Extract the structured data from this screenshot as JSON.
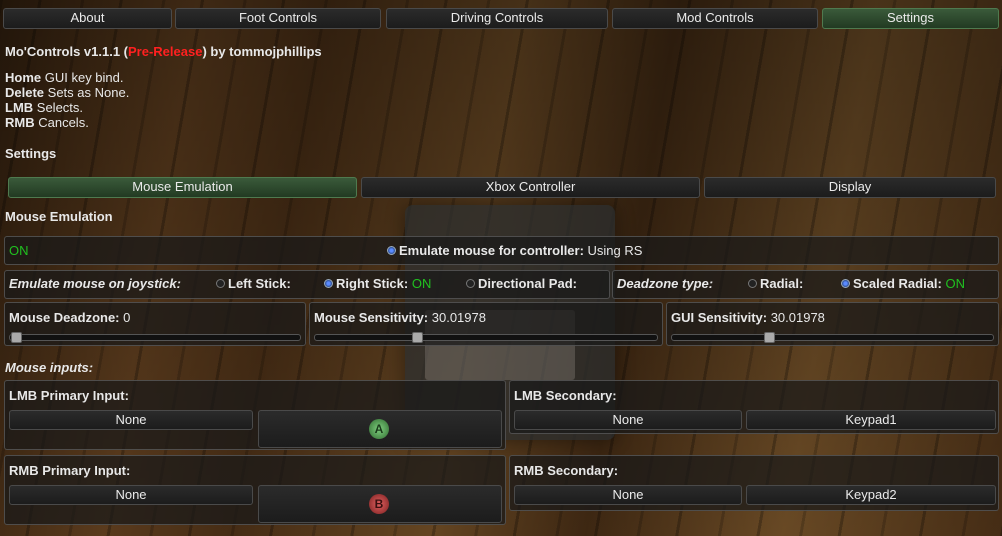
{
  "tabs": [
    {
      "label": "About"
    },
    {
      "label": "Foot Controls"
    },
    {
      "label": "Driving Controls"
    },
    {
      "label": "Mod Controls"
    },
    {
      "label": "Settings",
      "active": true
    }
  ],
  "header": {
    "title_prefix": "Mo'Controls v1.1.1 (",
    "prerelease": "Pre-Release",
    "title_suffix": ") by tommojphillips"
  },
  "keybinds": [
    {
      "key": "Home",
      "desc": " GUI key bind."
    },
    {
      "key": "Delete",
      "desc": " Sets as None."
    },
    {
      "key": "LMB",
      "desc": " Selects."
    },
    {
      "key": "RMB",
      "desc": " Cancels."
    }
  ],
  "settings_heading": "Settings",
  "subtabs": [
    {
      "label": "Mouse Emulation"
    },
    {
      "label": "Xbox Controller"
    },
    {
      "label": "Display"
    }
  ],
  "mouse_emulation": {
    "heading": "Mouse Emulation",
    "status": "ON",
    "emulate_label": "Emulate mouse for controller:",
    "emulate_value": " Using RS",
    "joystick_label": "Emulate mouse on joystick:",
    "left_stick": "Left Stick:",
    "right_stick": "Right Stick:",
    "right_stick_state": " ON",
    "dpad": "Directional Pad:",
    "deadzone_type_label": "Deadzone type:",
    "radial": "Radial:",
    "scaled_radial": "Scaled Radial:",
    "scaled_radial_state": " ON",
    "deadzone_label": "Mouse Deadzone:",
    "deadzone_value": " 0",
    "deadzone_level": 0,
    "sensitivity_label": "Mouse Sensitivity:",
    "sensitivity_value": " 30.01978",
    "sensitivity_level": 0.3,
    "gui_sensitivity_label": "GUI Sensitivity:",
    "gui_sensitivity_value": " 30.01978",
    "gui_sensitivity_level": 0.3
  },
  "mouse_inputs": {
    "heading": "Mouse inputs:",
    "lmb_primary_label": "LMB Primary Input:",
    "lmb_primary_value": "None",
    "lmb_primary_button": "A",
    "lmb_secondary_label": "LMB Secondary:",
    "lmb_secondary_value": "None",
    "lmb_secondary_key": "Keypad1",
    "rmb_primary_label": "RMB Primary Input:",
    "rmb_primary_value": "None",
    "rmb_primary_button": "B",
    "rmb_secondary_label": "RMB Secondary:",
    "rmb_secondary_value": "None",
    "rmb_secondary_key": "Keypad2"
  }
}
